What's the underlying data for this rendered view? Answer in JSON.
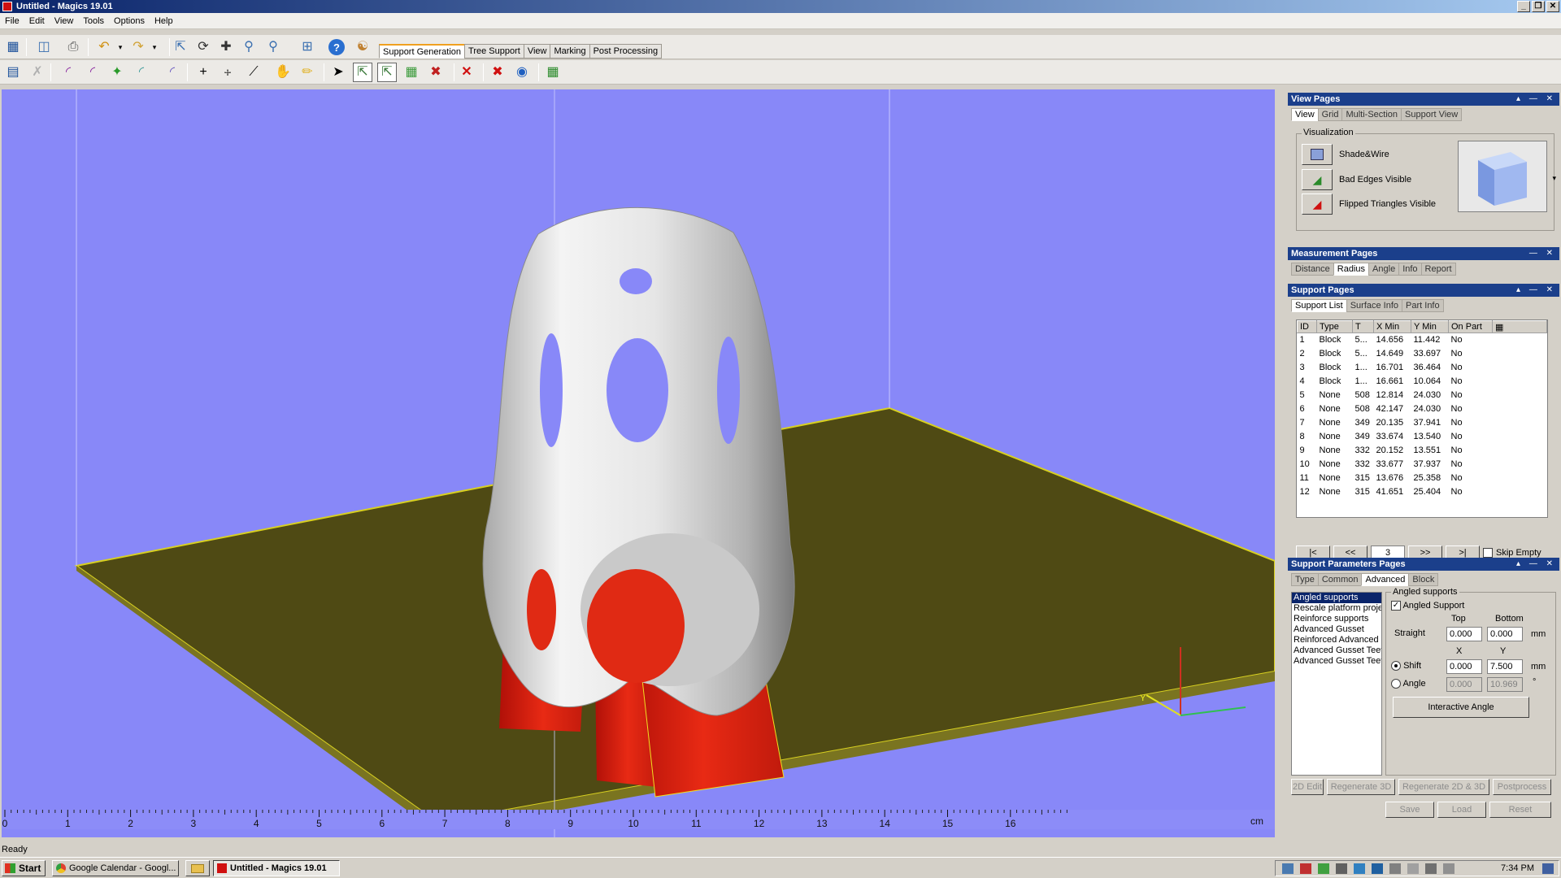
{
  "window": {
    "title": "Untitled - Magics 19.01",
    "min": "_",
    "restore": "❐",
    "close": "✕"
  },
  "menu": [
    "File",
    "Edit",
    "View",
    "Tools",
    "Options",
    "Help"
  ],
  "mode_tabs": [
    {
      "label": "Support Generation",
      "active": true
    },
    {
      "label": "Tree Support",
      "active": false
    },
    {
      "label": "View",
      "active": false
    },
    {
      "label": "Marking",
      "active": false
    },
    {
      "label": "Post Processing",
      "active": false
    }
  ],
  "viewport": {
    "ruler_unit": "cm",
    "ruler_ticks": [
      "0",
      "1",
      "2",
      "3",
      "4",
      "5",
      "6",
      "7",
      "8",
      "9",
      "10",
      "11",
      "12",
      "13",
      "14",
      "15",
      "16"
    ],
    "axis_y": "Y",
    "colors": {
      "background": "#8888f8",
      "platform": "#4f4a14",
      "part": "#e0e0e0",
      "support": "#e02010"
    }
  },
  "status": "Ready",
  "view_pages": {
    "title": "View Pages",
    "tabs": [
      {
        "label": "View",
        "active": true
      },
      {
        "label": "Grid",
        "active": false
      },
      {
        "label": "Multi-Section",
        "active": false
      },
      {
        "label": "Support View",
        "active": false
      }
    ],
    "group": "Visualization",
    "items": [
      "Shade&Wire",
      "Bad Edges Visible",
      "Flipped Triangles Visible"
    ]
  },
  "measurement_pages": {
    "title": "Measurement Pages",
    "tabs": [
      {
        "label": "Distance",
        "active": false
      },
      {
        "label": "Radius",
        "active": true
      },
      {
        "label": "Angle",
        "active": false
      },
      {
        "label": "Info",
        "active": false
      },
      {
        "label": "Report",
        "active": false
      }
    ]
  },
  "support_pages": {
    "title": "Support Pages",
    "tabs": [
      {
        "label": "Support List",
        "active": true
      },
      {
        "label": "Surface Info",
        "active": false
      },
      {
        "label": "Part Info",
        "active": false
      }
    ],
    "columns": [
      "ID",
      "Type",
      "T",
      "X Min",
      "Y Min",
      "On Part"
    ],
    "rows": [
      [
        "1",
        "Block",
        "5...",
        "14.656",
        "11.442",
        "No"
      ],
      [
        "2",
        "Block",
        "5...",
        "14.649",
        "33.697",
        "No"
      ],
      [
        "3",
        "Block",
        "1...",
        "16.701",
        "36.464",
        "No"
      ],
      [
        "4",
        "Block",
        "1...",
        "16.661",
        "10.064",
        "No"
      ],
      [
        "5",
        "None",
        "508",
        "12.814",
        "24.030",
        "No"
      ],
      [
        "6",
        "None",
        "508",
        "42.147",
        "24.030",
        "No"
      ],
      [
        "7",
        "None",
        "349",
        "20.135",
        "37.941",
        "No"
      ],
      [
        "8",
        "None",
        "349",
        "33.674",
        "13.540",
        "No"
      ],
      [
        "9",
        "None",
        "332",
        "20.152",
        "13.551",
        "No"
      ],
      [
        "10",
        "None",
        "332",
        "33.677",
        "37.937",
        "No"
      ],
      [
        "11",
        "None",
        "315",
        "13.676",
        "25.358",
        "No"
      ],
      [
        "12",
        "None",
        "315",
        "41.651",
        "25.404",
        "No"
      ]
    ],
    "nav": {
      "first": "|<",
      "prev": "<<",
      "page": "3",
      "next": ">>",
      "last": ">|",
      "skip_empty": "Skip Empty"
    }
  },
  "support_params": {
    "title": "Support Parameters Pages",
    "tabs": [
      {
        "label": "Type",
        "active": false
      },
      {
        "label": "Common",
        "active": false
      },
      {
        "label": "Advanced",
        "active": true
      },
      {
        "label": "Block",
        "active": false
      }
    ],
    "list": [
      "Angled supports",
      "Rescale platform proje",
      "Reinforce supports",
      "Advanced Gusset",
      "Reinforced Advanced (",
      "Advanced Gusset Teet",
      "Advanced Gusset Teet"
    ],
    "group": "Angled supports",
    "angled_support": "Angled Support",
    "top": "Top",
    "bottom": "Bottom",
    "straight": "Straight",
    "straight_top": "0.000",
    "straight_bottom": "0.000",
    "mm": "mm",
    "x": "X",
    "y": "Y",
    "shift": "Shift",
    "shift_x": "0.000",
    "shift_y": "7.500",
    "angle": "Angle",
    "angle_x": "0.000",
    "angle_y": "10.969",
    "deg": "°",
    "interactive_angle": "Interactive Angle",
    "buttons": [
      "2D Edit",
      "Regenerate 3D",
      "Regenerate 2D & 3D",
      "Postprocess"
    ],
    "save": "Save",
    "load": "Load",
    "reset": "Reset"
  },
  "taskbar": {
    "start": "Start",
    "tasks": [
      {
        "label": "Google Calendar - Googl...",
        "active": false
      },
      {
        "label": "Untitled - Magics 19.01",
        "active": true
      }
    ],
    "clock": "7:34 PM"
  }
}
